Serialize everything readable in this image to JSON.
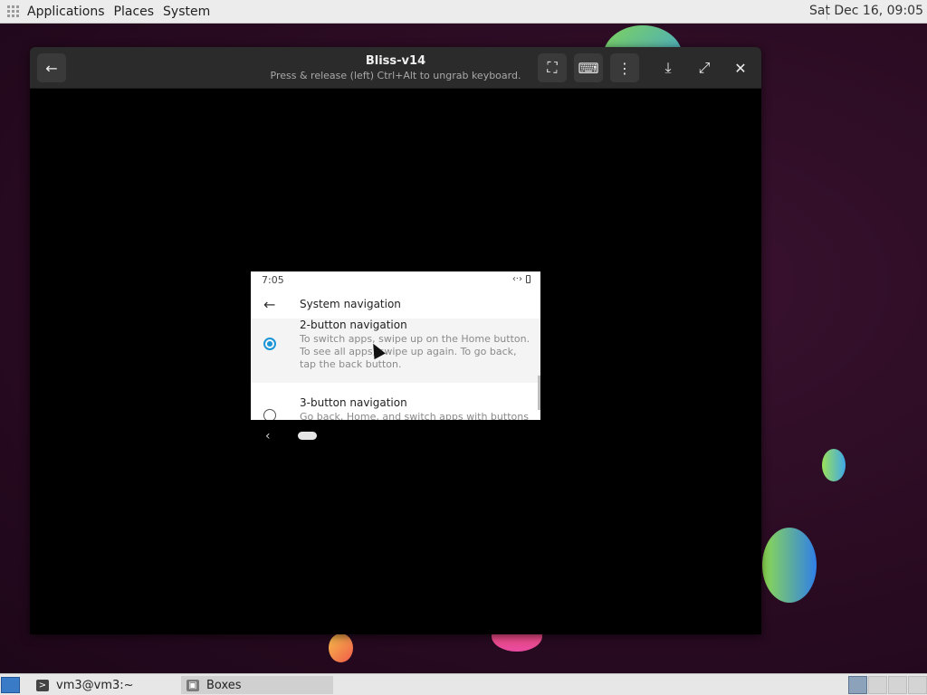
{
  "top_panel": {
    "menus": [
      "Applications",
      "Places",
      "System"
    ],
    "clock": "Sat Dec 16, 09:05"
  },
  "window": {
    "title": "Bliss-v14",
    "subtitle": "Press & release (left) Ctrl+Alt to ungrab keyboard.",
    "icons": {
      "back": "arrow-left-icon",
      "fullscreen": "fullscreen-icon",
      "keyboard": "keyboard-icon",
      "menu": "more-vertical-icon",
      "download": "download-icon",
      "expand": "expand-icon",
      "close": "close-icon"
    },
    "glyphs": {
      "back": "←",
      "fullscreen": "⛶",
      "keyboard": "⌨",
      "menu": "⋮",
      "download": "⤓",
      "expand": "⤢",
      "close": "✕"
    }
  },
  "android": {
    "status_time": "7:05",
    "status_signal": "‹·›",
    "back_glyph": "←",
    "title": "System navigation",
    "options": [
      {
        "title": "2-button navigation",
        "description": "To switch apps, swipe up on the Home button. To see all apps, swipe up again. To go back, tap the back button.",
        "selected": true
      },
      {
        "title": "3-button navigation",
        "description": "Go back, Home, and switch apps with buttons at",
        "selected": false
      }
    ],
    "nav_back_glyph": "‹"
  },
  "taskbar": {
    "tasks": [
      {
        "label": "vm3@vm3:~",
        "icon": "terminal-icon"
      },
      {
        "label": "Boxes",
        "icon": "boxes-icon"
      }
    ],
    "workspaces": 4,
    "active_workspace": 1,
    "colors": {
      "show_desktop": "#3a7bc8"
    }
  }
}
